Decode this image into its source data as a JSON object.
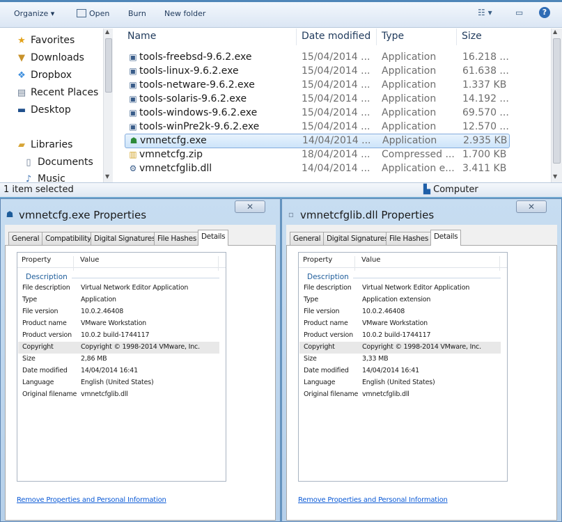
{
  "explorer": {
    "toolbar": {
      "organize": "Organize ▾",
      "open": "Open",
      "burn": "Burn",
      "new_folder": "New folder",
      "views": "☷ ▾"
    },
    "nav": {
      "favorites": "Favorites",
      "downloads": "Downloads",
      "dropbox": "Dropbox",
      "recent": "Recent Places",
      "desktop": "Desktop",
      "libraries": "Libraries",
      "documents": "Documents",
      "music": "Music"
    },
    "columns": {
      "name": "Name",
      "date": "Date modified",
      "type": "Type",
      "size": "Size"
    },
    "files": [
      {
        "name": "tools-freebsd-9.6.2.exe",
        "date": "15/04/2014 ...",
        "type": "Application",
        "size": "16.218 ..."
      },
      {
        "name": "tools-linux-9.6.2.exe",
        "date": "15/04/2014 ...",
        "type": "Application",
        "size": "61.638 ..."
      },
      {
        "name": "tools-netware-9.6.2.exe",
        "date": "15/04/2014 ...",
        "type": "Application",
        "size": "1.337 KB"
      },
      {
        "name": "tools-solaris-9.6.2.exe",
        "date": "15/04/2014 ...",
        "type": "Application",
        "size": "14.192 ..."
      },
      {
        "name": "tools-windows-9.6.2.exe",
        "date": "15/04/2014 ...",
        "type": "Application",
        "size": "69.570 ..."
      },
      {
        "name": "tools-winPre2k-9.6.2.exe",
        "date": "15/04/2014 ...",
        "type": "Application",
        "size": "12.570 ..."
      },
      {
        "name": "vmnetcfg.exe",
        "date": "14/04/2014 ...",
        "type": "Application",
        "size": "2.935 KB"
      },
      {
        "name": "vmnetcfg.zip",
        "date": "18/04/2014 ...",
        "type": "Compressed ...",
        "size": "1.700 KB"
      },
      {
        "name": "vmnetcfglib.dll",
        "date": "14/04/2014 ...",
        "type": "Application e...",
        "size": "3.411 KB"
      }
    ],
    "status": {
      "left": "1 item selected",
      "right": "Computer"
    }
  },
  "dialog_left": {
    "title": "vmnetcfg.exe Properties",
    "close": "✕",
    "tabs": [
      "General",
      "Compatibility",
      "Digital Signatures",
      "File Hashes",
      "Details"
    ],
    "grid_head": {
      "property": "Property",
      "value": "Value"
    },
    "group": "Description",
    "rows": [
      {
        "k": "File description",
        "v": "Virtual Network Editor Application"
      },
      {
        "k": "Type",
        "v": "Application"
      },
      {
        "k": "File version",
        "v": "10.0.2.46408"
      },
      {
        "k": "Product name",
        "v": "VMware Workstation"
      },
      {
        "k": "Product version",
        "v": "10.0.2 build-1744117"
      },
      {
        "k": "Copyright",
        "v": "Copyright © 1998-2014 VMware, Inc."
      },
      {
        "k": "Size",
        "v": "2,86 MB"
      },
      {
        "k": "Date modified",
        "v": "14/04/2014 16:41"
      },
      {
        "k": "Language",
        "v": "English (United States)"
      },
      {
        "k": "Original filename",
        "v": "vmnetcfglib.dll"
      }
    ],
    "link": "Remove Properties and Personal Information"
  },
  "dialog_right": {
    "title": "vmnetcfglib.dll Properties",
    "close": "✕",
    "tabs": [
      "General",
      "Digital Signatures",
      "File Hashes",
      "Details"
    ],
    "grid_head": {
      "property": "Property",
      "value": "Value"
    },
    "group": "Description",
    "rows": [
      {
        "k": "File description",
        "v": "Virtual Network Editor Application"
      },
      {
        "k": "Type",
        "v": "Application extension"
      },
      {
        "k": "File version",
        "v": "10.0.2.46408"
      },
      {
        "k": "Product name",
        "v": "VMware Workstation"
      },
      {
        "k": "Product version",
        "v": "10.0.2 build-1744117"
      },
      {
        "k": "Copyright",
        "v": "Copyright © 1998-2014 VMware, Inc."
      },
      {
        "k": "Size",
        "v": "3,33 MB"
      },
      {
        "k": "Date modified",
        "v": "14/04/2014 16:41"
      },
      {
        "k": "Language",
        "v": "English (United States)"
      },
      {
        "k": "Original filename",
        "v": "vmnetcfglib.dll"
      }
    ],
    "link": "Remove Properties and Personal Information"
  }
}
